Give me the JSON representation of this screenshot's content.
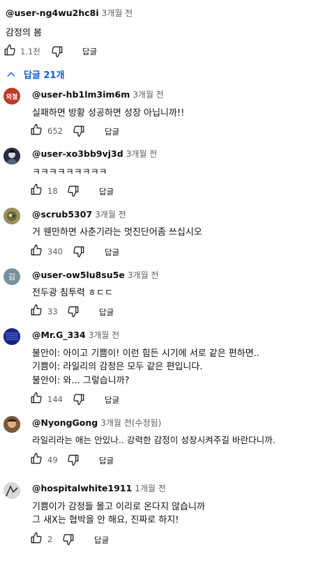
{
  "top_comment": {
    "handle": "@user-ng4wu2hc8i",
    "time": "3개월 전",
    "text": "감정의 봄",
    "likes": "1.1천",
    "reply_label": "답글"
  },
  "replies_toggle": {
    "chevron": "chevron-up-icon",
    "label": "답글 21개"
  },
  "replies": [
    {
      "handle": "@user-hb1lm3im6m",
      "time": "3개월 전",
      "lines": [
        "실패하면 방황 성공하면 성장 아닙니까!!"
      ],
      "likes": "652",
      "reply_label": "답글",
      "avatar_text": "의철",
      "avatar_color": "#c0392b"
    },
    {
      "handle": "@user-xo3bb9vj3d",
      "time": "3개월 전",
      "lines": [
        "ㅋㅋㅋㅋㅋㅋㅋㅋㅋ"
      ],
      "likes": "18",
      "reply_label": "답글",
      "avatar_text": "",
      "avatar_color": "#3a3f55"
    },
    {
      "handle": "@scrub5307",
      "time": "3개월 전",
      "lines": [
        "거 웬만하면 사춘기라는 멋진단어좀 쓰십시오"
      ],
      "likes": "340",
      "reply_label": "답글",
      "avatar_text": "",
      "avatar_color": "#a89a6a"
    },
    {
      "handle": "@user-ow5lu8su5e",
      "time": "3개월 전",
      "lines": [
        "전두광 침투력 ㅎㄷㄷ"
      ],
      "likes": "33",
      "reply_label": "답글",
      "avatar_text": "김",
      "avatar_color": "#78909c"
    },
    {
      "handle": "@Mr.G_334",
      "time": "3개월 전",
      "lines": [
        "불안이: 아이고 기쁨이! 이런 힘든 시기에 서로 같은 편하면..",
        "기쁨이: 라일리의 감정은 모두 같은 편입니다.",
        "불안이: 와... 그렇습니까?"
      ],
      "likes": "144",
      "reply_label": "답글",
      "avatar_text": "",
      "avatar_color": "#1c2fa0"
    },
    {
      "handle": "@NyongGong",
      "time": "3개월 전(수정됨)",
      "lines": [
        "라일리라는 애는 안있나.. 강력한 감정이 성장시켜주길 바란다니까."
      ],
      "likes": "49",
      "reply_label": "답글",
      "avatar_text": "",
      "avatar_color": "#8a6a4a"
    },
    {
      "handle": "@hospitalwhite1911",
      "time": "1개월 전",
      "lines": [
        "기쁨이가 감정들 몰고 이리로 온다지 않습니까",
        "그 새X는 협박을 안 해요, 진짜로 하지!"
      ],
      "likes": "2",
      "reply_label": "답글",
      "avatar_text": "",
      "avatar_color": "#c8c8c8"
    }
  ]
}
